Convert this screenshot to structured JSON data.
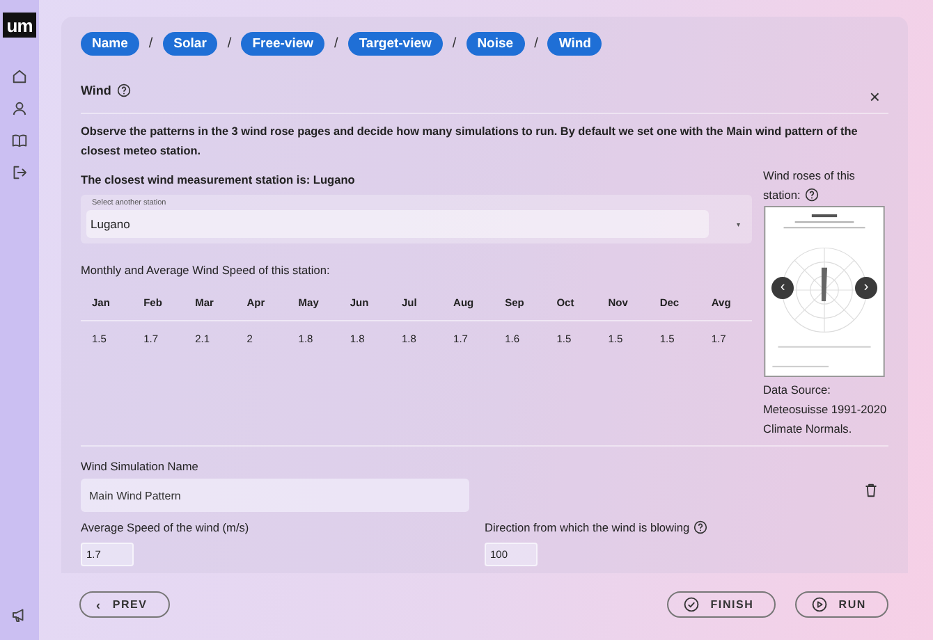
{
  "sidebar": {
    "logo": "um"
  },
  "breadcrumbs": [
    "Name",
    "Solar",
    "Free-view",
    "Target-view",
    "Noise",
    "Wind"
  ],
  "breadcrumb_separator": "/",
  "section": {
    "title": "Wind",
    "close": "×"
  },
  "description": "Observe the patterns in the 3 wind rose pages and decide how many simulations to run. By default we set one with the Main wind pattern of the closest meteo station.",
  "closest_station": "The closest wind measurement station is: Lugano",
  "station_select": {
    "label": "Select another station",
    "value": "Lugano",
    "caret": "▾"
  },
  "monthly_title": "Monthly and Average Wind Speed of this station:",
  "months": [
    {
      "label": "Jan",
      "value": "1.5"
    },
    {
      "label": "Feb",
      "value": "1.7"
    },
    {
      "label": "Mar",
      "value": "2.1"
    },
    {
      "label": "Apr",
      "value": "2"
    },
    {
      "label": "May",
      "value": "1.8"
    },
    {
      "label": "Jun",
      "value": "1.8"
    },
    {
      "label": "Jul",
      "value": "1.8"
    },
    {
      "label": "Aug",
      "value": "1.7"
    },
    {
      "label": "Sep",
      "value": "1.6"
    },
    {
      "label": "Oct",
      "value": "1.5"
    },
    {
      "label": "Nov",
      "value": "1.5"
    },
    {
      "label": "Dec",
      "value": "1.5"
    },
    {
      "label": "Avg",
      "value": "1.7"
    }
  ],
  "wind_roses": {
    "title_lines": [
      "Wind roses of this",
      "station:"
    ],
    "prev": "‹",
    "next": "›",
    "source": "Data Source: Meteosuisse 1991-2020 Climate Normals."
  },
  "simulation": {
    "name_label": "Wind Simulation Name",
    "name_value": "Main Wind Pattern",
    "speed_label": "Average Speed of the wind (m/s)",
    "speed_value": "1.7",
    "direction_label": "Direction from which the wind is blowing",
    "direction_value": "100"
  },
  "footer": [
    {
      "kind": "prev",
      "icon": "‹",
      "label": "PREV"
    },
    {
      "kind": "spacer"
    },
    {
      "kind": "finish",
      "label": "FINISH"
    },
    {
      "kind": "run",
      "label": "RUN"
    }
  ]
}
